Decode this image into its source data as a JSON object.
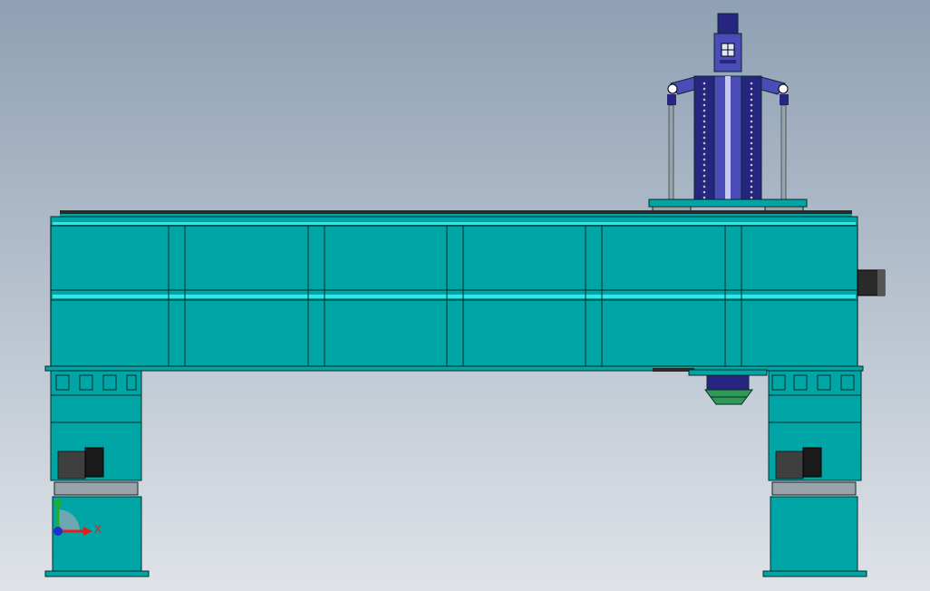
{
  "viewport": {
    "background_top": "#8fa0b4",
    "background_bottom": "#dfe3e8"
  },
  "model": {
    "body_color": "#00a6a6",
    "highlight_color": "#35e6e6",
    "outline_color": "#062b2b",
    "spindle_color": "#4c4cb8",
    "spindle_dark": "#262680",
    "motor_color": "#3f3f3f",
    "nozzle_color": "#2e9a55",
    "rod_color": "#9aa2aa"
  },
  "triad": {
    "x_label": "X",
    "x_color": "#e02020",
    "y_color": "#20b020",
    "z_color": "#2030d0"
  }
}
